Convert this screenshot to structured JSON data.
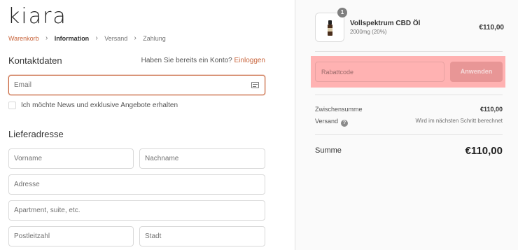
{
  "brand": {
    "logo_text": "kiara"
  },
  "breadcrumb": {
    "items": [
      {
        "label": "Warenkorb",
        "state": "link"
      },
      {
        "label": "Information",
        "state": "current"
      },
      {
        "label": "Versand",
        "state": "upcoming"
      },
      {
        "label": "Zahlung",
        "state": "upcoming"
      }
    ]
  },
  "contact": {
    "title": "Kontaktdaten",
    "account_prompt": "Haben Sie bereits ein Konto?",
    "login_label": "Einloggen",
    "email_placeholder": "Email",
    "newsletter_label": "Ich möchte News und exklusive Angebote erhalten"
  },
  "shipping": {
    "title": "Lieferadresse",
    "first_name_placeholder": "Vorname",
    "last_name_placeholder": "Nachname",
    "address_placeholder": "Adresse",
    "apartment_placeholder": "Apartment, suite, etc.",
    "zip_placeholder": "Postleitzahl",
    "city_placeholder": "Stadt"
  },
  "order": {
    "item": {
      "quantity": "1",
      "name": "Vollspektrum CBD Öl",
      "variant": "2000mg (20%)",
      "price": "€110,00"
    },
    "discount": {
      "placeholder": "Rabattcode",
      "apply_label": "Anwenden"
    },
    "subtotal_label": "Zwischensumme",
    "subtotal_value": "€110,00",
    "shipping_label": "Versand",
    "shipping_note": "Wird im nächsten Schritt berechnet",
    "total_label": "Summe",
    "total_value": "€110,00"
  },
  "colors": {
    "accent": "#c8643b",
    "highlight": "#ffb2b2"
  }
}
